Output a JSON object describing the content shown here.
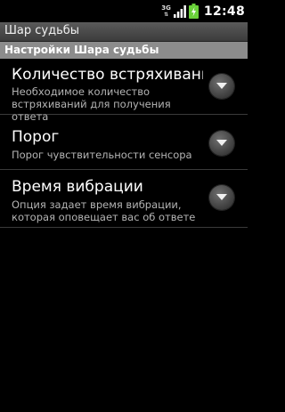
{
  "status_bar": {
    "network_label": "3G",
    "time": "12:48",
    "icons": [
      "network-3g-icon",
      "signal-strength-icon",
      "battery-charging-icon"
    ]
  },
  "app": {
    "title": "Шар судьбы"
  },
  "settings": {
    "header": "Настройки Шара судьбы",
    "items": [
      {
        "title": "Количество встряхиваний",
        "summary": "Необходимое количество встряхиваний для получения ответа",
        "action_icon": "chevron-down-icon"
      },
      {
        "title": "Порог",
        "summary": "Порог чувствительности сенсора",
        "action_icon": "chevron-down-icon"
      },
      {
        "title": "Время вибрации",
        "summary": "Опция задает время вибрации, которая оповещает вас об ответе",
        "action_icon": "chevron-down-icon"
      }
    ]
  },
  "colors": {
    "background": "#000000",
    "title_bar": "#4a4a4a",
    "section_header": "#8c8c8c",
    "summary_text": "#b4b4b4",
    "battery": "#6ad13a"
  }
}
